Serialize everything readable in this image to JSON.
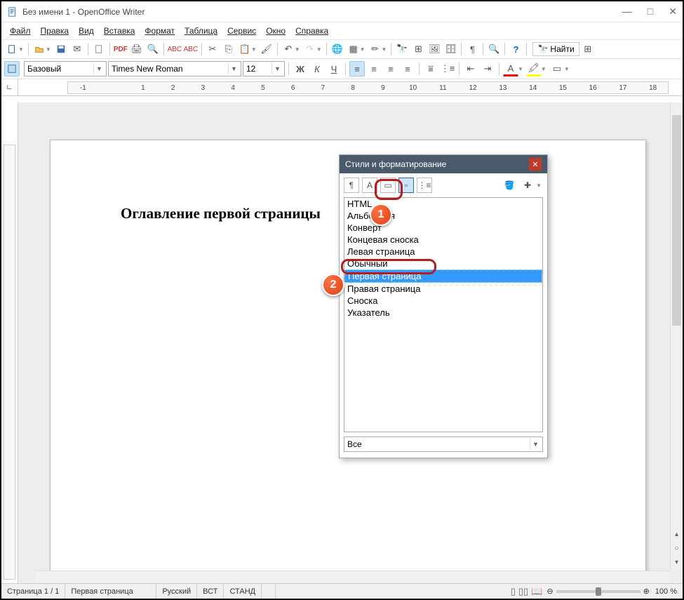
{
  "window": {
    "title": "Без имени 1 - OpenOffice Writer"
  },
  "menu": {
    "file": "Файл",
    "edit": "Правка",
    "view": "Вид",
    "insert": "Вставка",
    "format": "Формат",
    "table": "Таблица",
    "service": "Сервис",
    "window": "Окно",
    "help": "Справка"
  },
  "toolbar": {
    "find_label": "Найти"
  },
  "format_bar": {
    "style": "Базовый",
    "font": "Times New Roman",
    "size": "12"
  },
  "ruler": {
    "labels": [
      "-1",
      "",
      "1",
      "2",
      "3",
      "4",
      "5",
      "6",
      "7",
      "8",
      "9",
      "10",
      "11",
      "12",
      "13",
      "14",
      "15",
      "16",
      "17",
      "18"
    ]
  },
  "document": {
    "heading": "Оглавление первой страницы"
  },
  "styles_panel": {
    "title": "Стили и форматирование",
    "items": [
      "HTML",
      "Альбомная",
      "Конверт",
      "Концевая сноска",
      "Левая страница",
      "Обычный",
      "Первая страница",
      "Правая страница",
      "Сноска",
      "Указатель"
    ],
    "selected_index": 6,
    "filter": "Все"
  },
  "annotations": {
    "badge1": "1",
    "badge2": "2"
  },
  "status": {
    "page": "Страница 1 / 1",
    "page_style": "Первая страница",
    "lang": "Русский",
    "insert": "ВСТ",
    "mode": "СТАНД",
    "zoom": "100 %"
  }
}
